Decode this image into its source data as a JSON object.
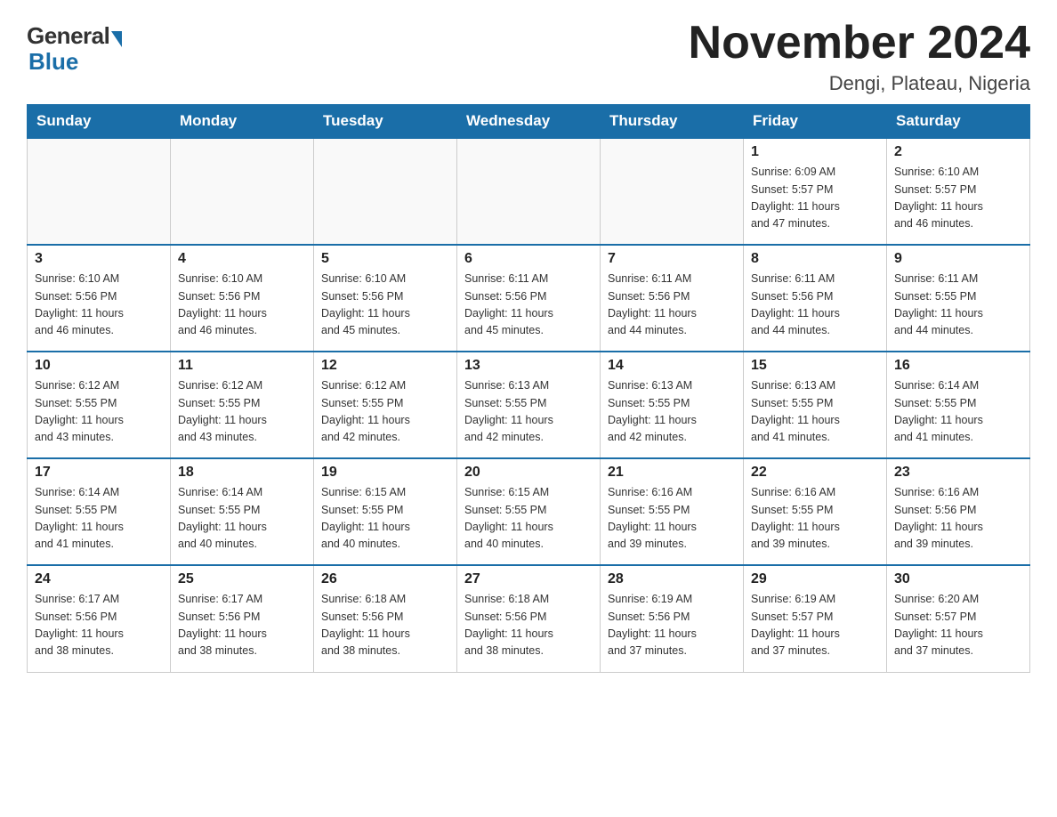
{
  "logo": {
    "general": "General",
    "blue": "Blue"
  },
  "title": "November 2024",
  "subtitle": "Dengi, Plateau, Nigeria",
  "days_of_week": [
    "Sunday",
    "Monday",
    "Tuesday",
    "Wednesday",
    "Thursday",
    "Friday",
    "Saturday"
  ],
  "weeks": [
    [
      {
        "day": "",
        "info": ""
      },
      {
        "day": "",
        "info": ""
      },
      {
        "day": "",
        "info": ""
      },
      {
        "day": "",
        "info": ""
      },
      {
        "day": "",
        "info": ""
      },
      {
        "day": "1",
        "info": "Sunrise: 6:09 AM\nSunset: 5:57 PM\nDaylight: 11 hours\nand 47 minutes."
      },
      {
        "day": "2",
        "info": "Sunrise: 6:10 AM\nSunset: 5:57 PM\nDaylight: 11 hours\nand 46 minutes."
      }
    ],
    [
      {
        "day": "3",
        "info": "Sunrise: 6:10 AM\nSunset: 5:56 PM\nDaylight: 11 hours\nand 46 minutes."
      },
      {
        "day": "4",
        "info": "Sunrise: 6:10 AM\nSunset: 5:56 PM\nDaylight: 11 hours\nand 46 minutes."
      },
      {
        "day": "5",
        "info": "Sunrise: 6:10 AM\nSunset: 5:56 PM\nDaylight: 11 hours\nand 45 minutes."
      },
      {
        "day": "6",
        "info": "Sunrise: 6:11 AM\nSunset: 5:56 PM\nDaylight: 11 hours\nand 45 minutes."
      },
      {
        "day": "7",
        "info": "Sunrise: 6:11 AM\nSunset: 5:56 PM\nDaylight: 11 hours\nand 44 minutes."
      },
      {
        "day": "8",
        "info": "Sunrise: 6:11 AM\nSunset: 5:56 PM\nDaylight: 11 hours\nand 44 minutes."
      },
      {
        "day": "9",
        "info": "Sunrise: 6:11 AM\nSunset: 5:55 PM\nDaylight: 11 hours\nand 44 minutes."
      }
    ],
    [
      {
        "day": "10",
        "info": "Sunrise: 6:12 AM\nSunset: 5:55 PM\nDaylight: 11 hours\nand 43 minutes."
      },
      {
        "day": "11",
        "info": "Sunrise: 6:12 AM\nSunset: 5:55 PM\nDaylight: 11 hours\nand 43 minutes."
      },
      {
        "day": "12",
        "info": "Sunrise: 6:12 AM\nSunset: 5:55 PM\nDaylight: 11 hours\nand 42 minutes."
      },
      {
        "day": "13",
        "info": "Sunrise: 6:13 AM\nSunset: 5:55 PM\nDaylight: 11 hours\nand 42 minutes."
      },
      {
        "day": "14",
        "info": "Sunrise: 6:13 AM\nSunset: 5:55 PM\nDaylight: 11 hours\nand 42 minutes."
      },
      {
        "day": "15",
        "info": "Sunrise: 6:13 AM\nSunset: 5:55 PM\nDaylight: 11 hours\nand 41 minutes."
      },
      {
        "day": "16",
        "info": "Sunrise: 6:14 AM\nSunset: 5:55 PM\nDaylight: 11 hours\nand 41 minutes."
      }
    ],
    [
      {
        "day": "17",
        "info": "Sunrise: 6:14 AM\nSunset: 5:55 PM\nDaylight: 11 hours\nand 41 minutes."
      },
      {
        "day": "18",
        "info": "Sunrise: 6:14 AM\nSunset: 5:55 PM\nDaylight: 11 hours\nand 40 minutes."
      },
      {
        "day": "19",
        "info": "Sunrise: 6:15 AM\nSunset: 5:55 PM\nDaylight: 11 hours\nand 40 minutes."
      },
      {
        "day": "20",
        "info": "Sunrise: 6:15 AM\nSunset: 5:55 PM\nDaylight: 11 hours\nand 40 minutes."
      },
      {
        "day": "21",
        "info": "Sunrise: 6:16 AM\nSunset: 5:55 PM\nDaylight: 11 hours\nand 39 minutes."
      },
      {
        "day": "22",
        "info": "Sunrise: 6:16 AM\nSunset: 5:55 PM\nDaylight: 11 hours\nand 39 minutes."
      },
      {
        "day": "23",
        "info": "Sunrise: 6:16 AM\nSunset: 5:56 PM\nDaylight: 11 hours\nand 39 minutes."
      }
    ],
    [
      {
        "day": "24",
        "info": "Sunrise: 6:17 AM\nSunset: 5:56 PM\nDaylight: 11 hours\nand 38 minutes."
      },
      {
        "day": "25",
        "info": "Sunrise: 6:17 AM\nSunset: 5:56 PM\nDaylight: 11 hours\nand 38 minutes."
      },
      {
        "day": "26",
        "info": "Sunrise: 6:18 AM\nSunset: 5:56 PM\nDaylight: 11 hours\nand 38 minutes."
      },
      {
        "day": "27",
        "info": "Sunrise: 6:18 AM\nSunset: 5:56 PM\nDaylight: 11 hours\nand 38 minutes."
      },
      {
        "day": "28",
        "info": "Sunrise: 6:19 AM\nSunset: 5:56 PM\nDaylight: 11 hours\nand 37 minutes."
      },
      {
        "day": "29",
        "info": "Sunrise: 6:19 AM\nSunset: 5:57 PM\nDaylight: 11 hours\nand 37 minutes."
      },
      {
        "day": "30",
        "info": "Sunrise: 6:20 AM\nSunset: 5:57 PM\nDaylight: 11 hours\nand 37 minutes."
      }
    ]
  ]
}
